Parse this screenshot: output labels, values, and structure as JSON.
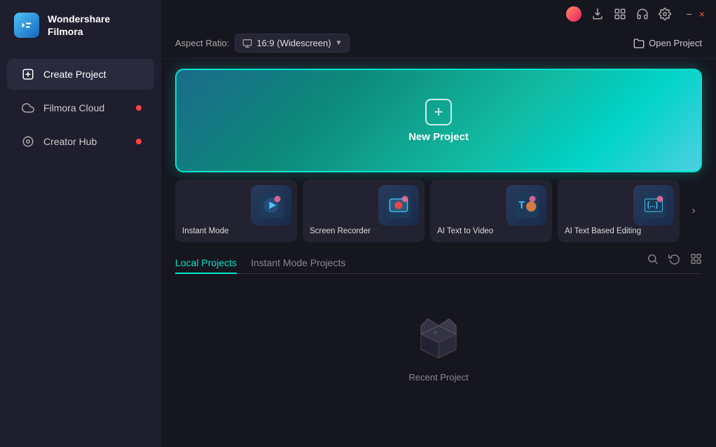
{
  "app": {
    "name": "Wondershare",
    "subtitle": "Filmora"
  },
  "titlebar": {
    "icons": [
      "avatar",
      "download",
      "grid",
      "headphone",
      "settings"
    ],
    "minimize_label": "−",
    "close_label": "×"
  },
  "topbar": {
    "aspect_label": "Aspect Ratio:",
    "aspect_value": "16:9 (Widescreen)",
    "open_project_label": "Open Project"
  },
  "new_project": {
    "label": "New Project"
  },
  "feature_cards": [
    {
      "id": "instant-mode",
      "label": "Instant Mode"
    },
    {
      "id": "screen-recorder",
      "label": "Screen Recorder"
    },
    {
      "id": "ai-text-to-video",
      "label": "AI Text to Video"
    },
    {
      "id": "ai-text-editing",
      "label": "AI Text Based Editing"
    }
  ],
  "nav": {
    "items": [
      {
        "id": "create-project",
        "label": "Create Project",
        "active": true,
        "badge": false
      },
      {
        "id": "filmora-cloud",
        "label": "Filmora Cloud",
        "active": false,
        "badge": true
      },
      {
        "id": "creator-hub",
        "label": "Creator Hub",
        "active": false,
        "badge": true
      }
    ]
  },
  "projects": {
    "tabs": [
      {
        "id": "local",
        "label": "Local Projects",
        "active": true
      },
      {
        "id": "instant",
        "label": "Instant Mode Projects",
        "active": false
      }
    ],
    "empty_label": "Recent Project"
  },
  "colors": {
    "accent": "#00e5cc",
    "badge": "#ff4444"
  }
}
